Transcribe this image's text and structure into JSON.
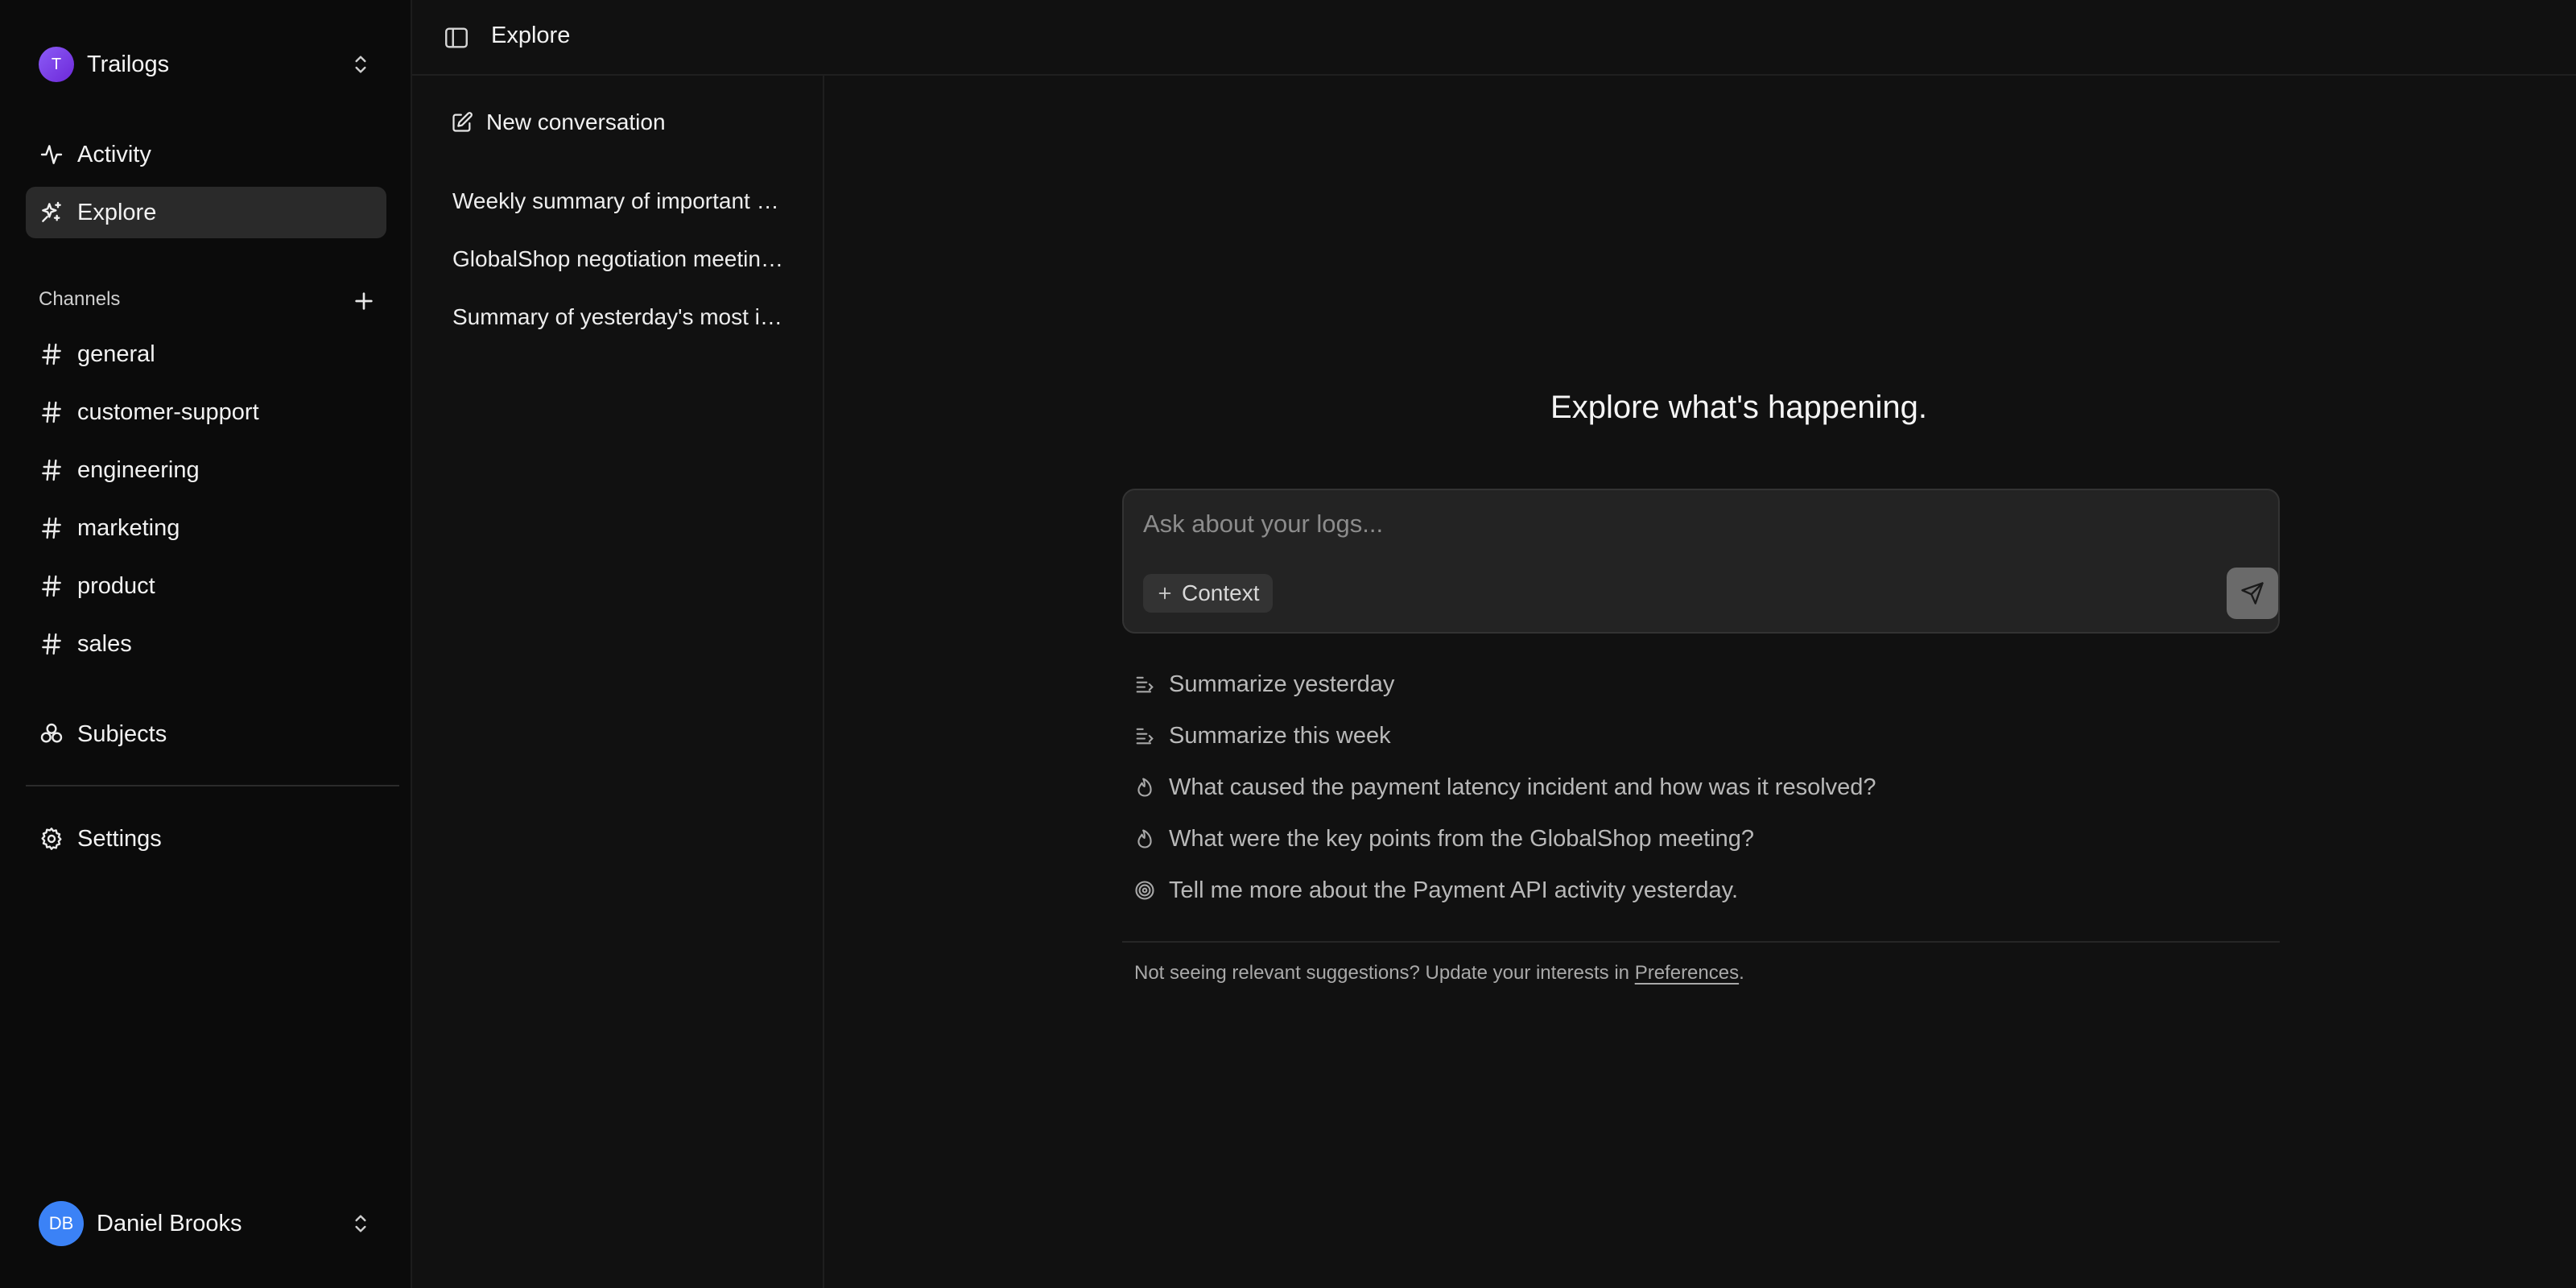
{
  "workspace": {
    "initial": "T",
    "name": "Trailogs",
    "color": "#7c3aed"
  },
  "nav": [
    {
      "label": "Activity",
      "icon": "activity-icon"
    },
    {
      "label": "Explore",
      "icon": "sparkles-icon",
      "active": true
    }
  ],
  "channels": {
    "title": "Channels",
    "items": [
      "general",
      "customer-support",
      "engineering",
      "marketing",
      "product",
      "sales"
    ]
  },
  "subjects": {
    "label": "Subjects",
    "icon": "subjects-icon"
  },
  "settings": {
    "label": "Settings",
    "icon": "gear-icon"
  },
  "user": {
    "initials": "DB",
    "name": "Daniel Brooks",
    "color": "#3b82f6"
  },
  "header": {
    "title": "Explore"
  },
  "conversations": {
    "new_label": "New conversation",
    "items": [
      "Weekly summary of important events",
      "GlobalShop negotiation meeting notes",
      "Summary of yesterday's most important updates"
    ]
  },
  "main": {
    "headline": "Explore what's happening.",
    "input_placeholder": "Ask about your logs...",
    "context_label": "Context",
    "suggestions": [
      {
        "icon": "summary-icon",
        "label": "Summarize yesterday"
      },
      {
        "icon": "summary-icon",
        "label": "Summarize this week"
      },
      {
        "icon": "flame-icon",
        "label": "What caused the payment latency incident and how was it resolved?"
      },
      {
        "icon": "flame-icon",
        "label": "What were the key points from the GlobalShop meeting?"
      },
      {
        "icon": "target-icon",
        "label": "Tell me more about the Payment API activity yesterday."
      }
    ],
    "footnote_prefix": "Not seeing relevant suggestions? Update your interests in ",
    "footnote_link": "Preferences",
    "footnote_suffix": "."
  }
}
